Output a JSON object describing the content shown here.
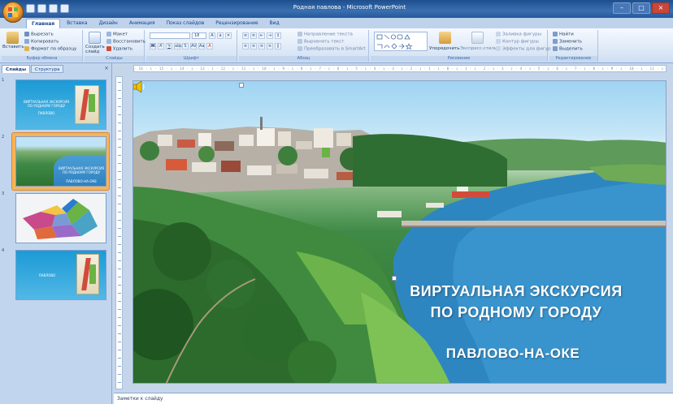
{
  "window": {
    "title": "Родная павлова - Microsoft PowerPoint"
  },
  "ribbon": {
    "tabs": [
      {
        "label": "Главная",
        "active": true
      },
      {
        "label": "Вставка"
      },
      {
        "label": "Дизайн"
      },
      {
        "label": "Анимация"
      },
      {
        "label": "Показ слайдов"
      },
      {
        "label": "Рецензирование"
      },
      {
        "label": "Вид"
      }
    ],
    "clipboard": {
      "paste": "Вставить",
      "cut": "Вырезать",
      "copy": "Копировать",
      "format_painter": "Формат по образцу",
      "label": "Буфер обмена"
    },
    "slides": {
      "new_slide": "Создать слайд",
      "layout": "Макет",
      "reset": "Восстановить",
      "delete": "Удалить",
      "label": "Слайды"
    },
    "font": {
      "size": "18",
      "label": "Шрифт"
    },
    "paragraph": {
      "direction": "Направление текста",
      "align": "Выровнять текст",
      "smartart": "Преобразовать в SmartArt",
      "label": "Абзац"
    },
    "drawing": {
      "arrange": "Упорядочить",
      "quick_styles": "Экспресс-стили",
      "fill": "Заливка фигуры",
      "outline": "Контур фигуры",
      "effects": "Эффекты для фигур",
      "label": "Рисование"
    },
    "editing": {
      "find": "Найти",
      "replace": "Заменить",
      "select": "Выделить",
      "label": "Редактирование"
    }
  },
  "left_pane": {
    "tab_slides": "Слайды",
    "tab_outline": "Структура",
    "close": "×",
    "thumbnails": [
      {
        "number": "1",
        "title": "ВИРТУАЛЬНАЯ ЭКСКУРСИЯ ПО РОДНОМУ ГОРОДУ",
        "subtitle": "ПАВЛОВО"
      },
      {
        "number": "2",
        "title": "ВИРТУАЛЬНАЯ ЭКСКУРСИЯ ПО РОДНОМУ ГОРОДУ",
        "subtitle": "ПАВЛОВО-НА-ОКЕ",
        "selected": true
      },
      {
        "number": "3",
        "title": ""
      },
      {
        "number": "4",
        "title": "ПАВЛОВО"
      }
    ]
  },
  "ruler": {
    "text": "· 16 · ı · 15 · ı · 14 · ı · 13 · ı · 12 · ı · 11 · ı · 10 · ı · 9 · ı · 8 · ı · 7 · ı · 6 · ı · 5 · ı · 4 · ı · 3 · ı · 2 · ı · 1 · ı · 0 · ı · 1 · ı · 2 · ı · 3 · ı · 4 · ı · 5 · ı · 6 · ı · 7 · ı · 8 · ı · 9 · ı · 10 · ı · 11 · ı · 12 · ı · 13 · ı · 14 · ı · 15 · ı · 16 ·"
  },
  "slide": {
    "title_line1": "ВИРТУАЛЬНАЯ ЭКСКУРСИЯ",
    "title_line2": "ПО РОДНОМУ ГОРОДУ",
    "subtitle": "ПАВЛОВО-НА-ОКЕ"
  },
  "notes": {
    "placeholder": "Заметки к слайду"
  }
}
